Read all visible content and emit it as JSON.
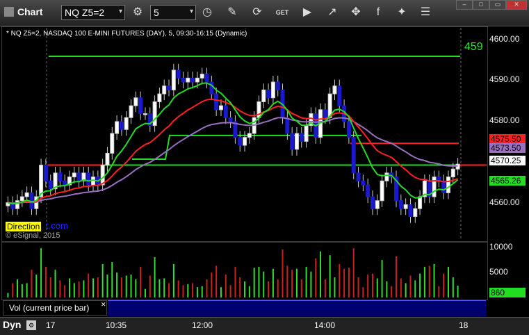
{
  "toolbar": {
    "title": "Chart",
    "symbol": "NQ Z5=2",
    "interval": "5",
    "icons": [
      "gear-icon",
      "clock-icon",
      "pencil-icon",
      "refresh-icon",
      "get-icon",
      "play-icon",
      "link-icon",
      "facebook-icon",
      "twitter-icon",
      "menu-icon"
    ]
  },
  "chart": {
    "info": "* NQ Z5=2, NASDAQ 100 E-MINI FUTURES (DAY), 5, 09:30-16:15 (Dynamic)",
    "price_axis": [
      "4600.00",
      "4590.00",
      "4580.00",
      "4570.00",
      "4560.00"
    ],
    "tags": {
      "top_green": "459",
      "red": "4575.50",
      "purple": "4573.50",
      "last": "4570.25",
      "green": "4565.26"
    },
    "direction_label": "Direction",
    "direction_link": "t.com",
    "copyright": "© eSignal, 2015",
    "colors": {
      "red": "#ff2020",
      "green": "#22dd22",
      "purple": "#9a70c0",
      "blue": "#1a1acc"
    }
  },
  "volume": {
    "axis": [
      "10000",
      "5000"
    ],
    "last": "860",
    "legend": "Vol (current price bar)"
  },
  "timebar": {
    "mode": "Dyn",
    "labels": [
      "17",
      "10:35",
      "12:00",
      "14:00",
      "18"
    ]
  },
  "chart_data": {
    "type": "candlestick",
    "title": "NQ Z5=2, NASDAQ 100 E-MINI FUTURES (DAY), 5, 09:30-16:15 (Dynamic)",
    "interval": "5",
    "ylim": [
      4552,
      4604
    ],
    "y_ticks": [
      4560,
      4570,
      4580,
      4590,
      4600
    ],
    "x_ticks": [
      "17",
      "10:35",
      "12:00",
      "14:00",
      "18"
    ],
    "last_price": 4570.25,
    "closes": [
      4560.5,
      4559,
      4561,
      4562,
      4563,
      4559,
      4562,
      4570,
      4566,
      4564,
      4568,
      4566,
      4565,
      4567,
      4568,
      4566,
      4568,
      4565,
      4567,
      4565,
      4570,
      4573,
      4578,
      4581,
      4579,
      4582,
      4585,
      4587,
      4583,
      4583,
      4580,
      4586,
      4588,
      4590,
      4589,
      4594,
      4592,
      4591,
      4592,
      4591,
      4592,
      4593,
      4591,
      4588,
      4584,
      4585,
      4582,
      4581,
      4577,
      4575,
      4577,
      4578,
      4582,
      4586,
      4589,
      4587,
      4591,
      4589,
      4582,
      4578,
      4574,
      4578,
      4576,
      4580,
      4583,
      4577,
      4584,
      4582,
      4588,
      4590,
      4585,
      4581,
      4577,
      4568,
      4566,
      4565,
      4562,
      4559,
      4561,
      4566,
      4568,
      4567,
      4561,
      4559,
      4560,
      4557,
      4559,
      4562,
      4566,
      4562,
      4567,
      4566,
      4563,
      4567,
      4569,
      4570.25
    ],
    "levels": [
      {
        "name": "red",
        "value": 4570
      },
      {
        "name": "red-upper",
        "value": 4575.5
      },
      {
        "name": "green-upper",
        "value": 4597.5
      },
      {
        "name": "green-mid",
        "value": 4577.5
      },
      {
        "name": "green-low",
        "value": 4570
      }
    ],
    "moving_averages": [
      {
        "name": "red",
        "value": 4575.5
      },
      {
        "name": "purple",
        "value": 4573.5
      },
      {
        "name": "green",
        "value": 4565.26
      }
    ],
    "volume_ylim": [
      0,
      10500
    ],
    "volume_ticks": [
      5000,
      10000
    ],
    "volume_last": 860
  }
}
